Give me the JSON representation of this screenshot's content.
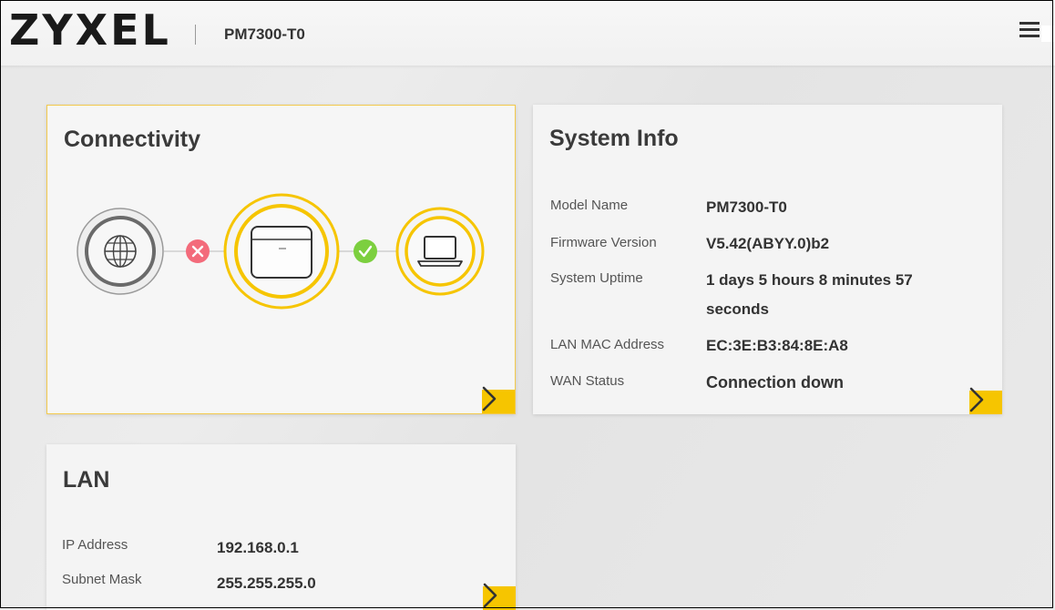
{
  "header": {
    "logo": "ZYXEL",
    "model": "PM7300-T0",
    "menu_icon": "hamburger-menu-icon"
  },
  "connectivity": {
    "title": "Connectivity",
    "internet_status": "disconnected",
    "lan_status": "connected",
    "icons": [
      "globe-icon",
      "router-icon",
      "laptop-icon"
    ],
    "accent_color": "#f6c500",
    "error_color": "#f36b7b",
    "ok_color": "#7ccf3f"
  },
  "system_info": {
    "title": "System Info",
    "rows": [
      {
        "label": "Model Name",
        "value": "PM7300-T0"
      },
      {
        "label": "Firmware Version",
        "value": "V5.42(ABYY.0)b2"
      },
      {
        "label": "System Uptime",
        "value_line1": "1 days 5 hours 8 minutes 57",
        "value_line2": "seconds"
      },
      {
        "label": "LAN MAC Address",
        "value": "EC:3E:B3:84:8E:A8"
      },
      {
        "label": "WAN Status",
        "value": "Connection down"
      }
    ]
  },
  "lan": {
    "title": "LAN",
    "rows": [
      {
        "label": "IP Address",
        "value": "192.168.0.1"
      },
      {
        "label": "Subnet Mask",
        "value": "255.255.255.0"
      }
    ]
  }
}
